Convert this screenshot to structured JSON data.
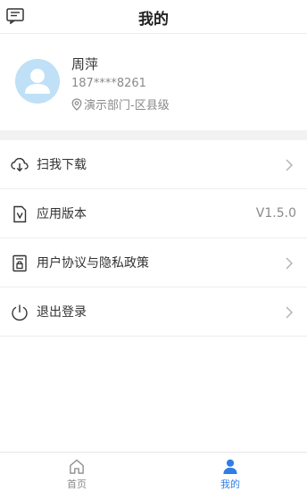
{
  "header": {
    "title": "我的"
  },
  "profile": {
    "name": "周萍",
    "phone": "187****8261",
    "department": "演示部门-区县级"
  },
  "menu": {
    "items": [
      {
        "label": "扫我下载",
        "icon": "download-icon"
      },
      {
        "label": "应用版本",
        "icon": "version-icon",
        "value": "V1.5.0"
      },
      {
        "label": "用户协议与隐私政策",
        "icon": "document-lock-icon"
      },
      {
        "label": "退出登录",
        "icon": "power-icon"
      }
    ]
  },
  "tabbar": {
    "tabs": [
      {
        "label": "首页",
        "icon": "home-icon",
        "active": false
      },
      {
        "label": "我的",
        "icon": "user-icon",
        "active": true
      }
    ]
  },
  "colors": {
    "accent": "#2f7ee5",
    "avatar_bg": "#bfe0f6",
    "divider": "#f2f2f2"
  }
}
